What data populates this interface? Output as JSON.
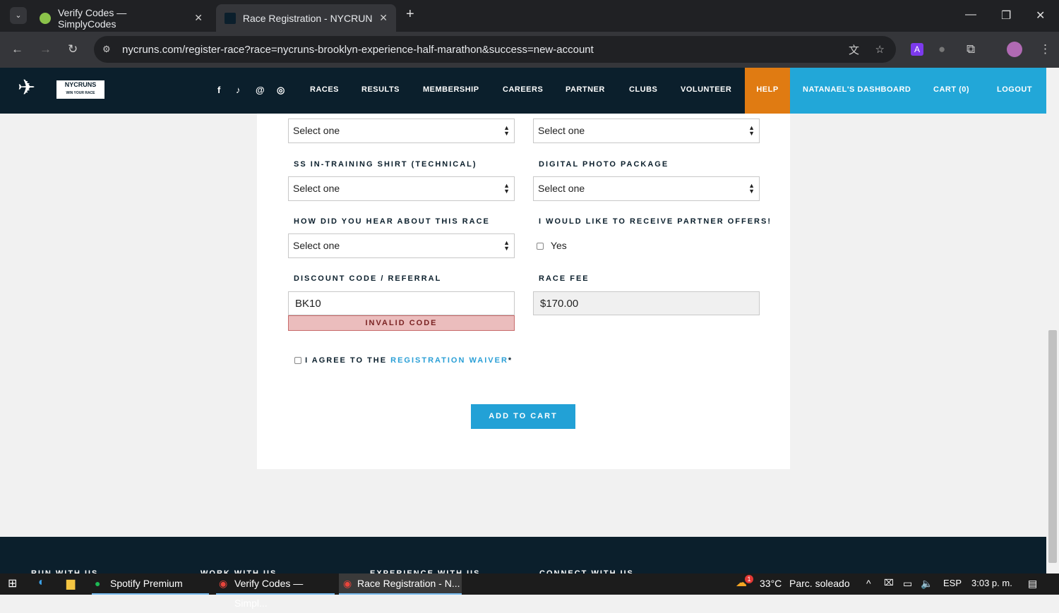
{
  "browser": {
    "tabs": [
      {
        "title": "Verify Codes — SimplyCodes"
      },
      {
        "title": "Race Registration - NYCRUNS B"
      }
    ],
    "url": "nycruns.com/register-race?race=nycruns-brooklyn-experience-half-marathon&success=new-account"
  },
  "site": {
    "logo_main": "NYCRUNS",
    "logo_sub": "WIN YOUR RACE",
    "social": [
      "f",
      "♪",
      "@",
      "◎"
    ],
    "nav": [
      "RACES",
      "RESULTS",
      "MEMBERSHIP",
      "CAREERS",
      "PARTNER",
      "CLUBS",
      "VOLUNTEER",
      "HELP",
      "NATANAEL'S DASHBOARD",
      "CART (0)",
      "LOGOUT"
    ],
    "colors": {
      "nav_bg": "#0b1f2c",
      "help": "#e07b12",
      "account": "#22a7d8"
    }
  },
  "form": {
    "select_placeholder": "Select one",
    "shirt_label": "SS IN-TRAINING SHIRT (TECHNICAL)",
    "photo_label": "DIGITAL PHOTO PACKAGE",
    "hear_label": "HOW DID YOU HEAR ABOUT THIS RACE",
    "partner_label": "I WOULD LIKE TO RECEIVE PARTNER OFFERS!",
    "partner_yes": "Yes",
    "discount_label": "DISCOUNT CODE / REFERRAL",
    "discount_value": "BK10",
    "discount_error": "INVALID CODE",
    "fee_label": "RACE FEE",
    "fee_value": "$170.00",
    "agree_prefix": "I AGREE TO THE ",
    "agree_link": "REGISTRATION WAIVER",
    "agree_suffix": "*",
    "submit": "ADD TO CART"
  },
  "footer": [
    "RUN WITH US",
    "WORK WITH US",
    "EXPERIENCE WITH US",
    "CONNECT WITH US"
  ],
  "taskbar": {
    "apps": [
      "Spotify Premium",
      "Verify Codes — Simpl...",
      "Race Registration - N..."
    ],
    "weather": "33°C",
    "weather_desc": "Parc. soleado",
    "lang": "ESP",
    "time": "3:03 p. m.",
    "badge": "1"
  }
}
